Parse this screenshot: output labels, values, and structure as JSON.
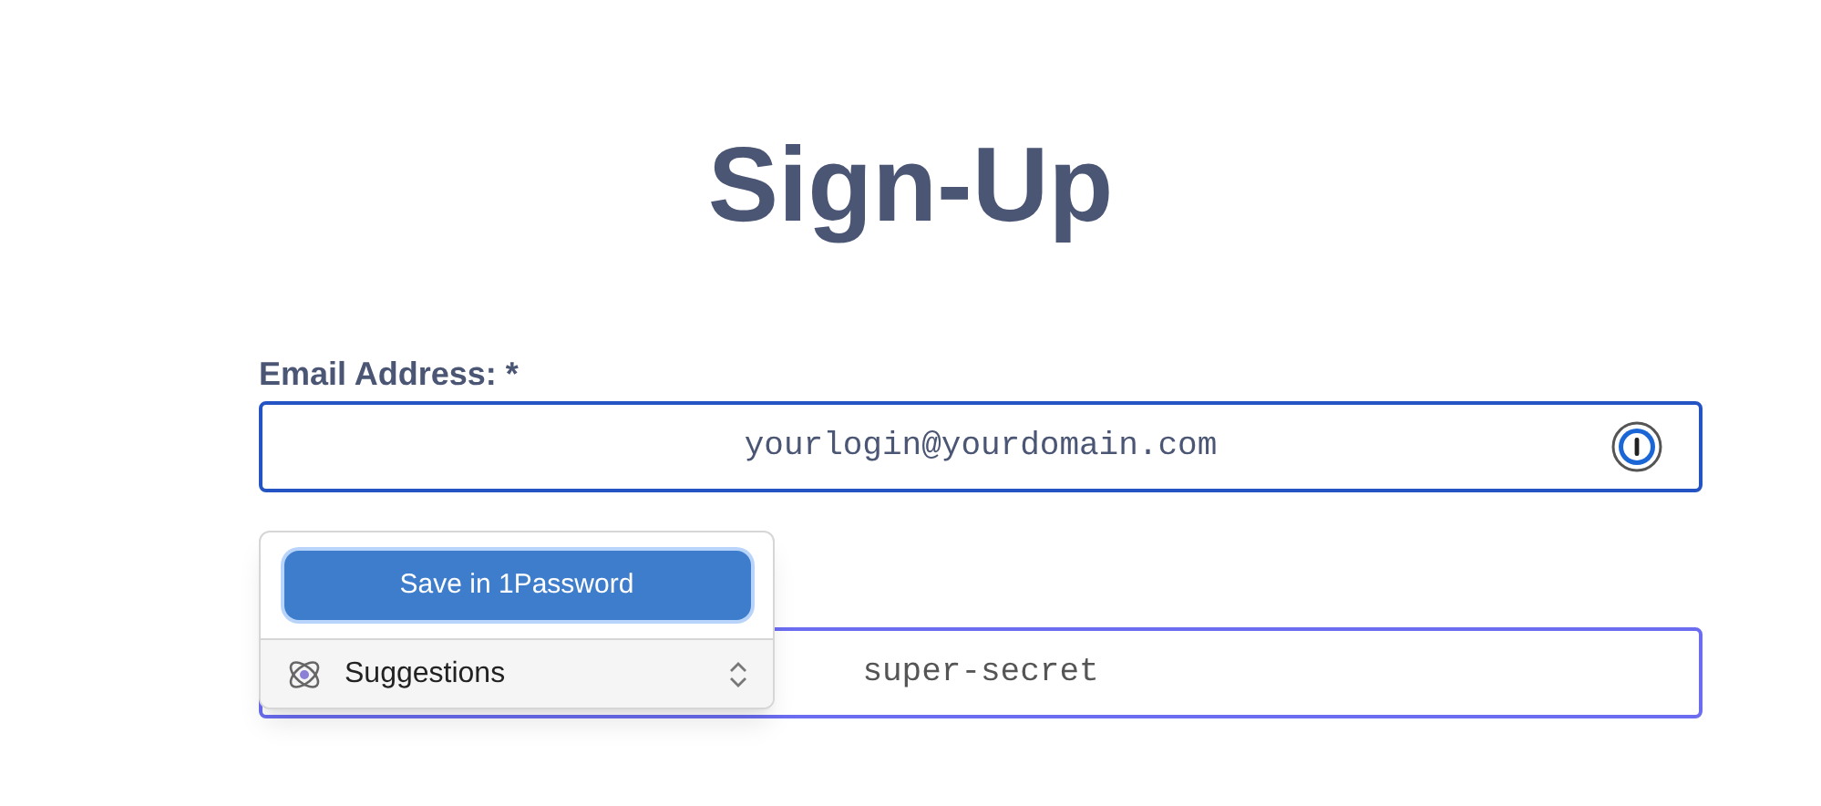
{
  "title": "Sign-Up",
  "email": {
    "label": "Email Address: *",
    "value": "yourlogin@yourdomain.com",
    "focused": true
  },
  "popup": {
    "save_button": "Save in 1Password",
    "suggestions": "Suggestions"
  },
  "password": {
    "value": "super-secret",
    "focused": false
  }
}
